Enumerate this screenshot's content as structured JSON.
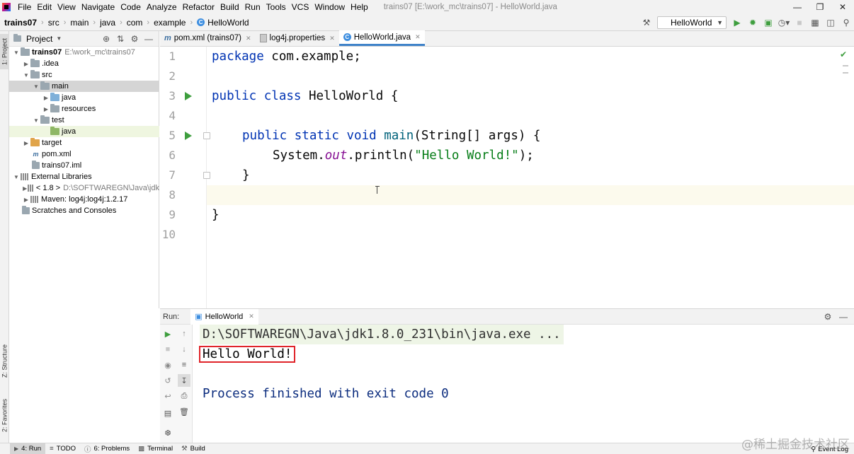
{
  "menubar": {
    "items": [
      "File",
      "Edit",
      "View",
      "Navigate",
      "Code",
      "Analyze",
      "Refactor",
      "Build",
      "Run",
      "Tools",
      "VCS",
      "Window",
      "Help"
    ],
    "window_title": "trains07 [E:\\work_mc\\trains07] - HelloWorld.java"
  },
  "navbar": {
    "breadcrumbs": [
      "trains07",
      "src",
      "main",
      "java",
      "com",
      "example",
      "HelloWorld"
    ],
    "run_config": "HelloWorld"
  },
  "left_strip": {
    "project_tab": "1: Project",
    "structure_tab": "Z: Structure",
    "favorites_tab": "2: Favorites"
  },
  "project_panel": {
    "title": "Project",
    "tree": [
      {
        "label": "trains07",
        "detail": "E:\\work_mc\\trains07",
        "icon": "module-folder",
        "expanded": true
      },
      {
        "label": ".idea",
        "icon": "folder",
        "expanded": false
      },
      {
        "label": "src",
        "icon": "folder",
        "expanded": true
      },
      {
        "label": "main",
        "icon": "folder",
        "expanded": true
      },
      {
        "label": "java",
        "icon": "source-folder",
        "expanded": false
      },
      {
        "label": "resources",
        "icon": "folder",
        "expanded": false
      },
      {
        "label": "test",
        "icon": "folder",
        "expanded": true
      },
      {
        "label": "java",
        "icon": "test-folder"
      },
      {
        "label": "target",
        "icon": "excluded-folder",
        "expanded": false
      },
      {
        "label": "pom.xml",
        "icon": "maven-file"
      },
      {
        "label": "trains07.iml",
        "icon": "iml-file"
      },
      {
        "label": "External Libraries",
        "icon": "library",
        "expanded": true
      },
      {
        "label": "< 1.8 >",
        "detail": "D:\\SOFTWAREGN\\Java\\jdk",
        "icon": "library",
        "expanded": false
      },
      {
        "label": "Maven: log4j:log4j:1.2.17",
        "icon": "library",
        "expanded": false
      },
      {
        "label": "Scratches and Consoles",
        "icon": "scratches"
      }
    ]
  },
  "tabs": [
    {
      "label": "pom.xml (trains07)",
      "icon": "maven-icon",
      "active": false
    },
    {
      "label": "log4j.properties",
      "icon": "properties-icon",
      "active": false
    },
    {
      "label": "HelloWorld.java",
      "icon": "class-icon",
      "active": true
    }
  ],
  "editor": {
    "line_numbers": [
      "1",
      "2",
      "3",
      "4",
      "5",
      "6",
      "7",
      "8",
      "9",
      "10"
    ],
    "lines": {
      "l1_kw": "package",
      "l1_rest": " com.example;",
      "l3_kw": "public class",
      "l3_rest": " HelloWorld {",
      "l5_kw": "public static void",
      "l5_fn": "main",
      "l5_rest": "(String[] args) {",
      "l6_a": "System.",
      "l6_field": "out",
      "l6_b": ".println(",
      "l6_str": "\"Hello World!\"",
      "l6_c": ");",
      "l7": "}",
      "l9": "}"
    }
  },
  "run_panel": {
    "label": "Run:",
    "tab": "HelloWorld",
    "console": {
      "command": "D:\\SOFTWAREGN\\Java\\jdk1.8.0_231\\bin\\java.exe ...",
      "output": "Hello World!",
      "exit": "Process finished with exit code 0"
    }
  },
  "statusbar": {
    "run": "4: Run",
    "todo": "TODO",
    "problems": "6: Problems",
    "terminal": "Terminal",
    "build": "Build",
    "event_log": "Event Log"
  },
  "watermark": "@稀土掘金技术社区",
  "colors": {
    "keyword": "#0033b3",
    "string": "#067d17",
    "static_field": "#871094",
    "exit_text": "#0b2c7e",
    "highlight_box": "#e0242a",
    "run_green": "#3e9e3e"
  }
}
